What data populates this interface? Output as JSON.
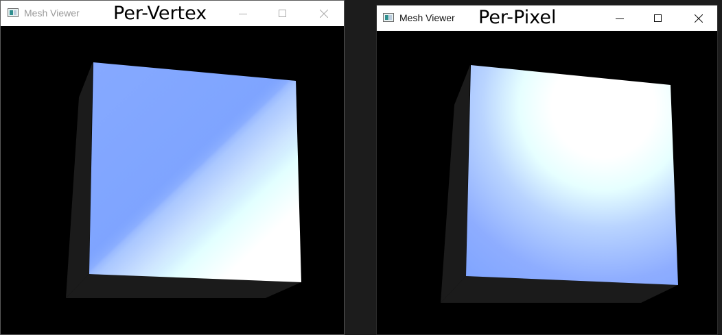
{
  "left_window": {
    "title": "Mesh Viewer",
    "caption": "Per-Vertex",
    "icons": {
      "app": "app-icon",
      "minimize": "minimize-icon",
      "maximize": "maximize-icon",
      "close": "close-icon"
    }
  },
  "right_window": {
    "title": "Mesh Viewer",
    "caption": "Per-Pixel",
    "icons": {
      "app": "app-icon",
      "minimize": "minimize-icon",
      "maximize": "maximize-icon",
      "close": "close-icon"
    }
  },
  "colors": {
    "cube_base": "#7fa6ff",
    "highlight": "#ffffff",
    "cyan_tint": "#dfffff",
    "cube_side": "#1b1b1b",
    "viewport_background": "#000000"
  }
}
